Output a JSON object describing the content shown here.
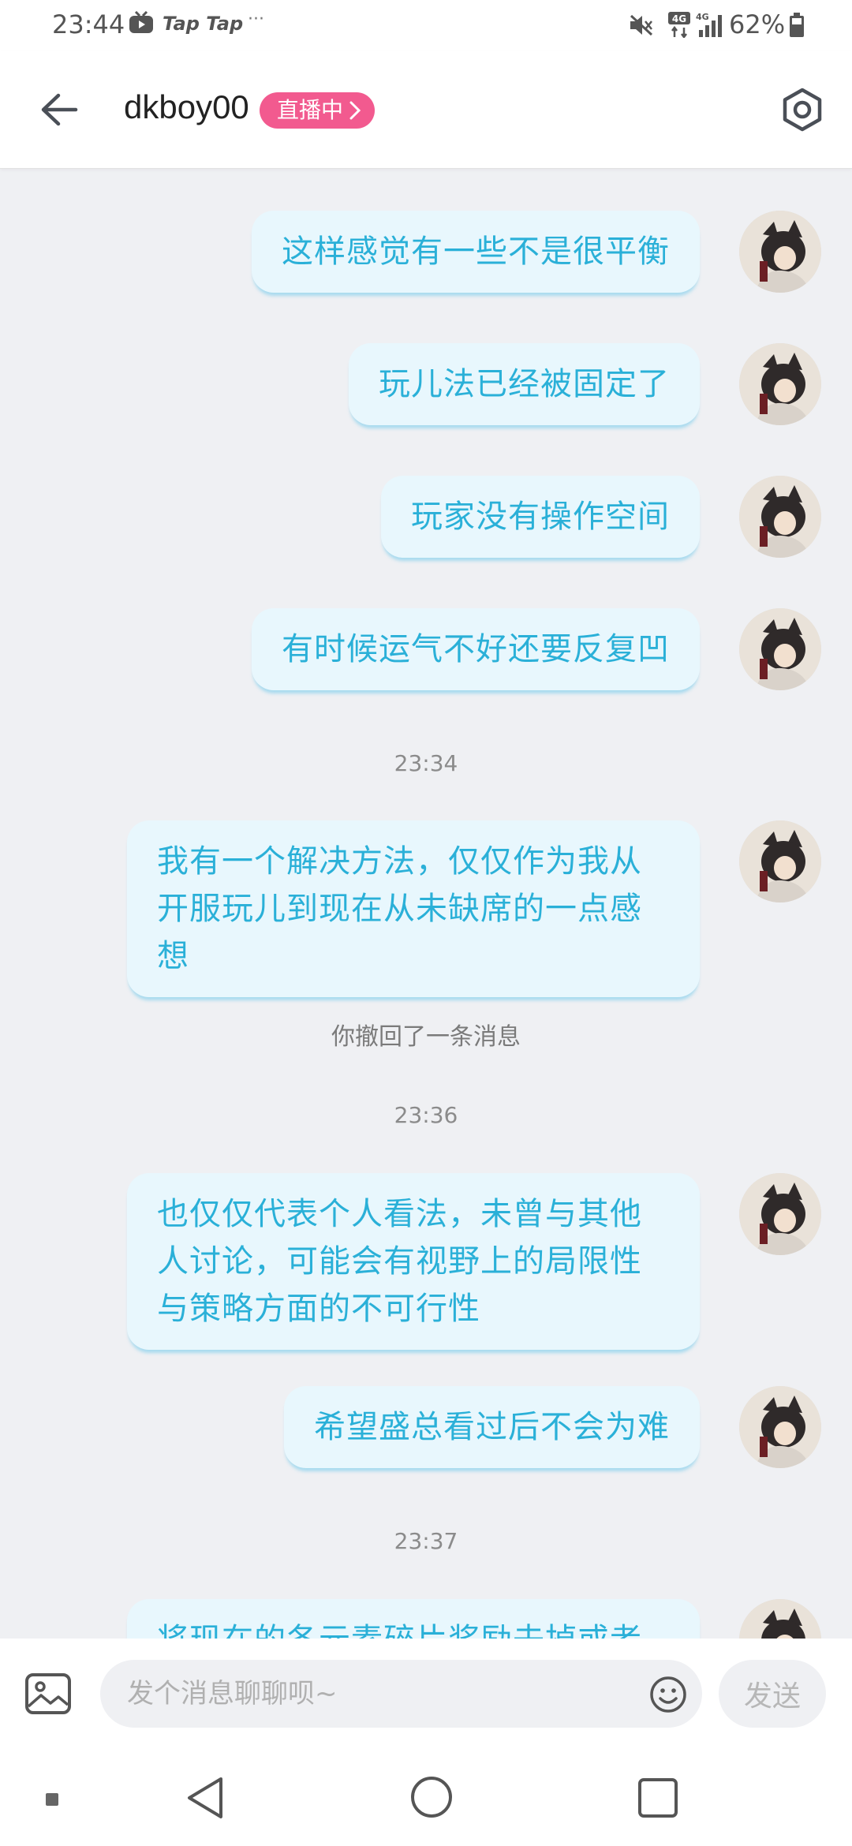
{
  "status_bar": {
    "time": "23:44",
    "app_name": "Tap Tap",
    "dots": "···",
    "network_1": "4G",
    "network_2": "4G",
    "battery": "62%"
  },
  "header": {
    "title": "dkboy00",
    "live_badge": "直播中"
  },
  "messages": [
    {
      "type": "outgoing",
      "text": "这样感觉有一些不是很平衡"
    },
    {
      "type": "outgoing",
      "text": "玩儿法已经被固定了"
    },
    {
      "type": "outgoing",
      "text": "玩家没有操作空间"
    },
    {
      "type": "outgoing",
      "text": "有时候运气不好还要反复凹"
    },
    {
      "type": "time",
      "text": "23:34"
    },
    {
      "type": "outgoing",
      "text": "我有一个解决方法，仅仅作为我从开服玩儿到现在从未缺席的一点感想"
    },
    {
      "type": "notice",
      "text": "你撤回了一条消息"
    },
    {
      "type": "time",
      "text": "23:36"
    },
    {
      "type": "outgoing",
      "text": "也仅仅代表个人看法，未曾与其他人讨论，可能会有视野上的局限性与策略方面的不可行性"
    },
    {
      "type": "outgoing",
      "text": "希望盛总看过后不会为难"
    },
    {
      "type": "time",
      "text": "23:37"
    },
    {
      "type": "outgoing",
      "text": "将现在的各元素碎片奖励去掉或者"
    }
  ],
  "input": {
    "placeholder": "发个消息聊聊呗~",
    "value": "",
    "send_label": "发送"
  },
  "colors": {
    "bubble_bg": "#e8f7fd",
    "bubble_text": "#2ab0d8",
    "live_badge": "#f25a8f",
    "chat_bg": "#eff0f3"
  },
  "icons": {
    "back": "arrow-left-icon",
    "settings": "hexagon-gear-icon",
    "image": "image-icon",
    "emoji": "smiley-icon"
  }
}
